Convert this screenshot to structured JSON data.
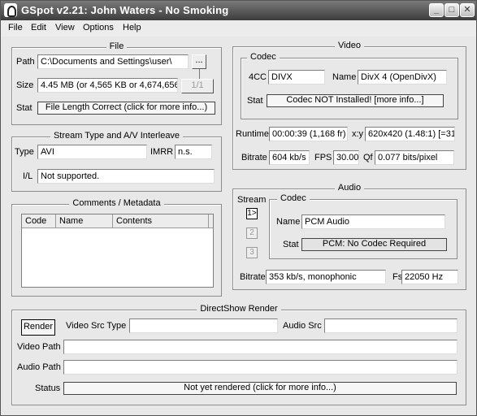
{
  "window": {
    "title": "GSpot v2.21: John Waters - No Smoking"
  },
  "titlebar_buttons": {
    "minimize": "_",
    "maximize": "□",
    "close": "✕"
  },
  "menu": [
    "File",
    "Edit",
    "View",
    "Options",
    "Help"
  ],
  "file": {
    "legend": "File",
    "path_label": "Path",
    "path_value": "C:\\Documents and Settings\\user\\",
    "browse_label": "...",
    "size_label": "Size",
    "size_value": "4.45 MB (or 4,565 KB or 4,674,656",
    "part_label": "1/1",
    "stat_label": "Stat",
    "stat_value": "File Length Correct (click for more info...)"
  },
  "stream": {
    "legend": "Stream Type and A/V Interleave",
    "type_label": "Type",
    "type_value": "AVI",
    "imrr_label": "IMRR",
    "imrr_value": "n.s.",
    "il_label": "I/L",
    "il_value": "Not supported."
  },
  "comments": {
    "legend": "Comments / Metadata",
    "columns": [
      "Code",
      "Name",
      "Contents"
    ]
  },
  "video": {
    "legend": "Video",
    "codec_legend": "Codec",
    "fourcc_label": "4CC",
    "fourcc_value": "DIVX",
    "name_label": "Name",
    "name_value": "DivX 4 (OpenDivX)",
    "stat_label": "Stat",
    "stat_value": "Codec NOT Installed!  [more info...]",
    "runtime_label": "Runtime",
    "runtime_value": "00:00:39 (1,168 fr)",
    "xy_label": "x:y",
    "xy_value": "620x420 (1.48:1) [=31:",
    "bitrate_label": "Bitrate",
    "bitrate_value": "604 kb/s",
    "fps_label": "FPS",
    "fps_value": "30.00",
    "qf_label": "Qf",
    "qf_value": "0.077 bits/pixel"
  },
  "audio": {
    "legend": "Audio",
    "stream_label": "Stream",
    "streams": [
      "1>",
      "2",
      "3"
    ],
    "codec_legend": "Codec",
    "name_label": "Name",
    "name_value": "PCM Audio",
    "stat_label": "Stat",
    "stat_value": "PCM: No Codec Required",
    "bitrate_label": "Bitrate",
    "bitrate_value": "353 kb/s, monophonic",
    "fs_label": "Fs",
    "fs_value": "22050 Hz"
  },
  "render": {
    "legend": "DirectShow Render",
    "render_button": "Render",
    "video_src_type_label": "Video Src Type",
    "video_src_type_value": "",
    "audio_src_label": "Audio Src",
    "audio_src_value": "",
    "video_path_label": "Video Path",
    "video_path_value": "",
    "audio_path_label": "Audio Path",
    "audio_path_value": "",
    "status_label": "Status",
    "status_value": "Not yet rendered (click for more info...)"
  }
}
